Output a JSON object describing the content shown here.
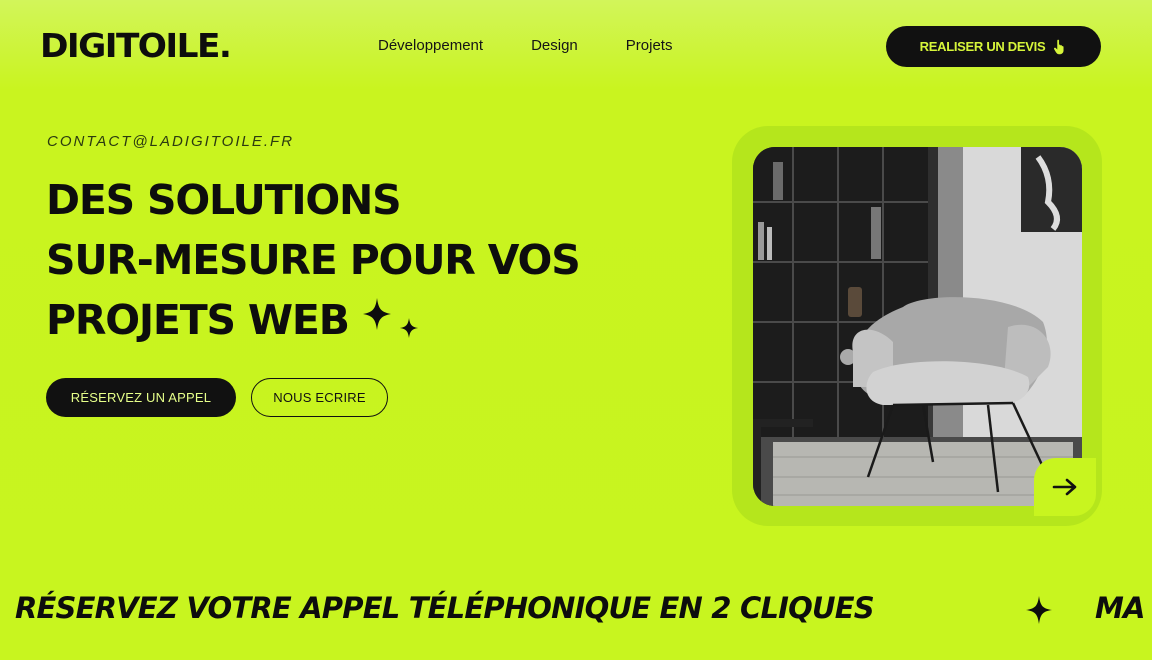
{
  "header": {
    "logo": "DIGITOILE.",
    "nav": [
      "Développement",
      "Design",
      "Projets"
    ],
    "cta_label": "REALISER UN DEVIS",
    "cta_icon": "hand-pointer-icon"
  },
  "hero": {
    "email": "CONTACT@LADIGITOILE.FR",
    "headline": [
      "DES SOLUTIONS",
      "SUR-MESURE POUR VOS",
      "PROJETS WEB"
    ],
    "headline_icon": "sparkles-icon",
    "primary_button": "RÉSERVEZ UN APPEL",
    "secondary_button": "NOUS ECRIRE",
    "image_alt_icon": "armchair-photo",
    "arrow_icon": "arrow-right-icon"
  },
  "marquee": {
    "text": "RÉSERVEZ VOTRE APPEL TÉLÉPHONIQUE EN 2 CLIQUES",
    "next_text": "MA",
    "separator_icon": "star-icon"
  },
  "colors": {
    "accent": "#c8f51f",
    "dark": "#111111",
    "frame": "#b5e61c"
  }
}
